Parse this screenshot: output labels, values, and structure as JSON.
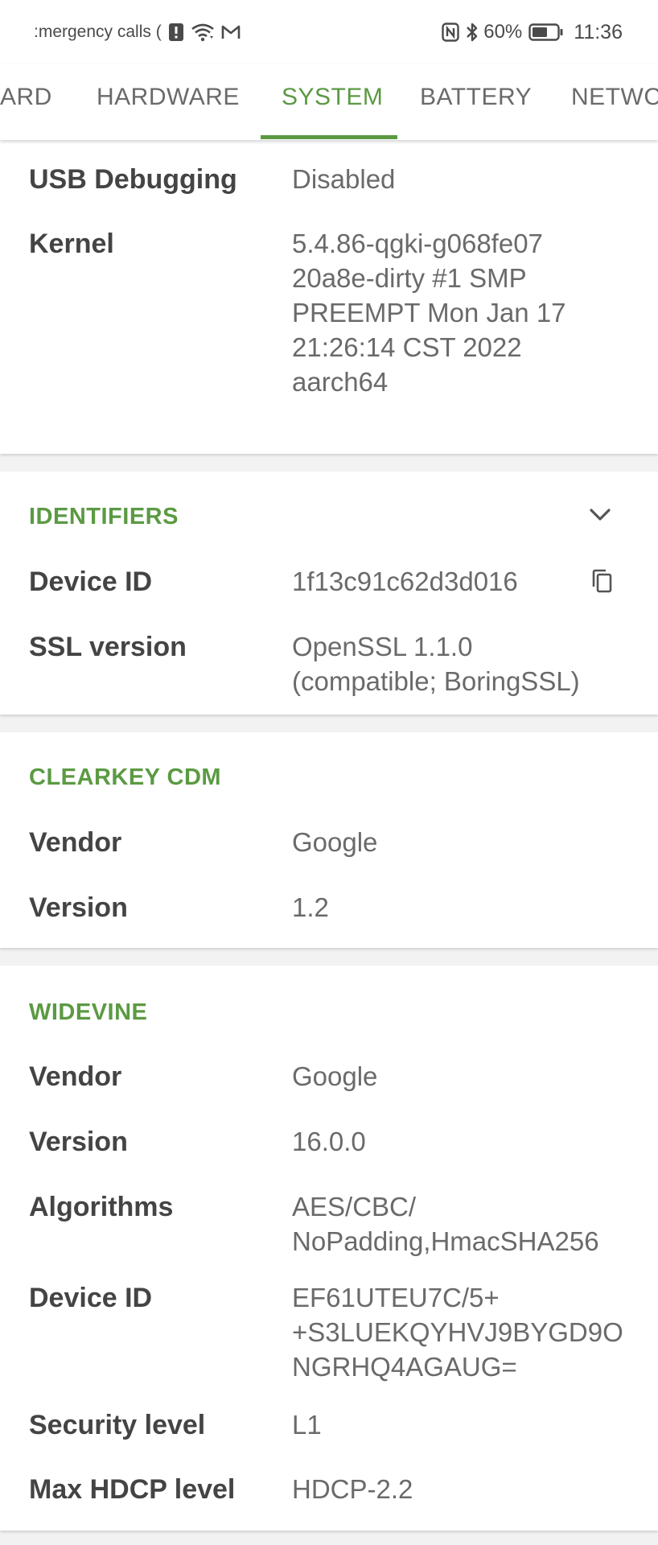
{
  "status_bar": {
    "carrier_text": ":mergency calls (",
    "battery_percent": "60%",
    "time": "11:36",
    "icons": [
      "alert-icon",
      "wifi-icon",
      "gmail-icon",
      "nfc-icon",
      "bluetooth-icon",
      "battery-icon"
    ]
  },
  "tabs": [
    {
      "label": "ARD"
    },
    {
      "label": "HARDWARE"
    },
    {
      "label": "SYSTEM"
    },
    {
      "label": "BATTERY"
    },
    {
      "label": "NETWC"
    }
  ],
  "active_tab": "SYSTEM",
  "colors": {
    "accent": "#5b9a43",
    "label": "#444444",
    "value": "#6a6a6a",
    "background": "#f2f2f2"
  },
  "system_card": {
    "rows": [
      {
        "label": "USB Debugging",
        "value": "Disabled"
      },
      {
        "label": "Kernel",
        "value": "5.4.86-qgki-g068fe07\n20a8e-dirty #1 SMP\nPREEMPT Mon Jan 17\n21:26:14 CST 2022\naarch64"
      }
    ]
  },
  "identifiers": {
    "title": "IDENTIFIERS",
    "rows": [
      {
        "label": "Device ID",
        "value": "1f13c91c62d3d016"
      },
      {
        "label": "SSL version",
        "value": "OpenSSL 1.1.0\n(compatible; BoringSSL)"
      }
    ]
  },
  "clearkey": {
    "title": "CLEARKEY CDM",
    "rows": [
      {
        "label": "Vendor",
        "value": "Google"
      },
      {
        "label": "Version",
        "value": "1.2"
      }
    ]
  },
  "widevine": {
    "title": "WIDEVINE",
    "rows": [
      {
        "label": "Vendor",
        "value": "Google"
      },
      {
        "label": "Version",
        "value": "16.0.0"
      },
      {
        "label": "Algorithms",
        "value": "AES/CBC/\nNoPadding,HmacSHA256"
      },
      {
        "label": "Device ID",
        "value": "EF61UTEU7C/5+\n+S3LUEKQYHVJ9BYGD9O\nNGRHQ4AGAUG="
      },
      {
        "label": "Security level",
        "value": "L1"
      },
      {
        "label": "Max HDCP level",
        "value": "HDCP-2.2"
      }
    ]
  }
}
